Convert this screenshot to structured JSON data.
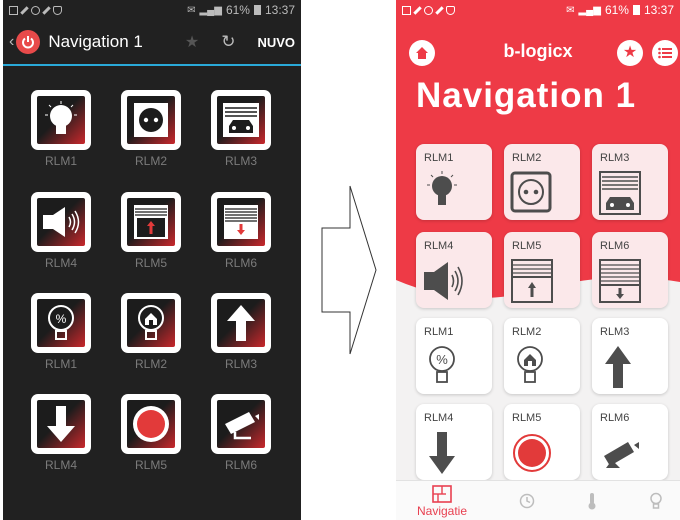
{
  "colors": {
    "accent_red": "#ee3a46",
    "left_bg": "#212121",
    "divider_blue": "#2aa9d8",
    "tile_pink": "#fbe8ea"
  },
  "left_phone": {
    "status": {
      "battery": "61%",
      "time": "13:37"
    },
    "title": "Navigation 1",
    "nuvo": "NUVO",
    "tiles": [
      {
        "label": "RLM1",
        "icon": "lightbulb-icon"
      },
      {
        "label": "RLM2",
        "icon": "socket-icon"
      },
      {
        "label": "RLM3",
        "icon": "garage-car-icon"
      },
      {
        "label": "RLM4",
        "icon": "speaker-icon"
      },
      {
        "label": "RLM5",
        "icon": "shutter-up-icon"
      },
      {
        "label": "RLM6",
        "icon": "shutter-down-icon"
      },
      {
        "label": "RLM1",
        "icon": "dimmer-bulb-icon"
      },
      {
        "label": "RLM2",
        "icon": "house-bulb-icon"
      },
      {
        "label": "RLM3",
        "icon": "arrow-up-icon"
      },
      {
        "label": "RLM4",
        "icon": "arrow-down-icon"
      },
      {
        "label": "RLM5",
        "icon": "record-button-icon"
      },
      {
        "label": "RLM6",
        "icon": "camera-icon"
      }
    ]
  },
  "right_phone": {
    "status": {
      "battery": "61%",
      "time": "13:37"
    },
    "brand": "b-logicx",
    "title": "Navigation 1",
    "tiles": [
      {
        "label": "RLM1",
        "icon": "lightbulb-icon"
      },
      {
        "label": "RLM2",
        "icon": "socket-icon"
      },
      {
        "label": "RLM3",
        "icon": "garage-car-icon"
      },
      {
        "label": "RLM4",
        "icon": "speaker-icon"
      },
      {
        "label": "RLM5",
        "icon": "shutter-up-icon"
      },
      {
        "label": "RLM6",
        "icon": "shutter-down-icon"
      },
      {
        "label": "RLM1",
        "icon": "dimmer-bulb-icon"
      },
      {
        "label": "RLM2",
        "icon": "house-bulb-icon"
      },
      {
        "label": "RLM3",
        "icon": "arrow-up-icon"
      },
      {
        "label": "RLM4",
        "icon": "arrow-down-icon"
      },
      {
        "label": "RLM5",
        "icon": "record-button-icon"
      },
      {
        "label": "RLM6",
        "icon": "camera-icon"
      }
    ],
    "bottom_nav": {
      "navigatie": "Navigatie"
    }
  }
}
